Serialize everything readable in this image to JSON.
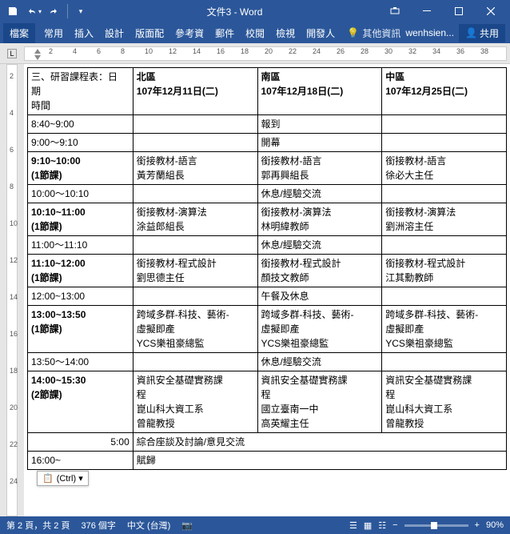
{
  "titlebar": {
    "title": "文件3 - Word"
  },
  "qat": {
    "save": "save",
    "undo": "undo",
    "redo": "redo"
  },
  "ribbon": {
    "file": "檔案",
    "tabs": [
      "常用",
      "插入",
      "設計",
      "版面配",
      "參考資",
      "郵件",
      "校閱",
      "檢視",
      "開發人"
    ],
    "tellme": "其他資訊",
    "user": "wenhsien...",
    "share": "共用"
  },
  "ruler_h": [
    "2",
    "4",
    "6",
    "8",
    "10",
    "12",
    "14",
    "16",
    "18",
    "20",
    "22",
    "24",
    "26",
    "28",
    "30",
    "32",
    "34",
    "36",
    "38"
  ],
  "ruler_v": [
    "2",
    "4",
    "6",
    "8",
    "10",
    "12",
    "14",
    "16",
    "18",
    "20",
    "22",
    "24"
  ],
  "table": {
    "r1": {
      "c1a": "三、研習課程表：日",
      "c1b": "期",
      "c1c": "時間",
      "c2": "北區",
      "c2b": "107年12月11日(二)",
      "c3": "南區",
      "c3b": "107年12月18日(二)",
      "c4": "中區",
      "c4b": "107年12月25日(二)"
    },
    "r2": {
      "c1": "8:40~9:00",
      "c3": "報到"
    },
    "r3": {
      "c1": "9:00～9:10",
      "c3": "開幕"
    },
    "r4": {
      "c1a": "9:10~10:00",
      "c1b": "(1節課)",
      "c2a": "銜接教材-語言",
      "c2b": "黃芳蘭組長",
      "c3a": "銜接教材-語言",
      "c3b": "郭再興組長",
      "c4a": "銜接教材-語言",
      "c4b": "徐必大主任"
    },
    "r5": {
      "c1": "10:00～10:10",
      "c3": "休息/經驗交流"
    },
    "r6": {
      "c1a": "10:10~11:00",
      "c1b": "(1節課)",
      "c2a": "銜接教材-演算法",
      "c2b": "涂益郎組長",
      "c3a": "銜接教材-演算法",
      "c3b": "林明緯教師",
      "c4a": "銜接教材-演算法",
      "c4b": "劉洲溶主任"
    },
    "r7": {
      "c1": "11:00～11:10",
      "c3": "休息/經驗交流"
    },
    "r8": {
      "c1a": "11:10~12:00",
      "c1b": "(1節課)",
      "c2a": "銜接教材-程式設計",
      "c2b": "劉思德主任",
      "c3a": "銜接教材-程式設計",
      "c3b": "顏技文教師",
      "c4a": "銜接教材-程式設計",
      "c4b": "江其勳教師"
    },
    "r9": {
      "c1": "12:00~13:00",
      "c3": "午餐及休息"
    },
    "r10": {
      "c1a": "13:00~13:50",
      "c1b": "(1節課)",
      "c2a": "跨域多群-科技、藝術-",
      "c2b": "虛擬即產",
      "c2c": "YCS樂祖豪總監",
      "c3a": "跨域多群-科技、藝術-",
      "c3b": "虛擬即產",
      "c3c": "YCS樂祖豪總監",
      "c4a": "跨域多群-科技、藝術-",
      "c4b": "虛擬即產",
      "c4c": "YCS樂祖豪總監"
    },
    "r11": {
      "c1": "13:50～14:00",
      "c3": "休息/經驗交流"
    },
    "r12": {
      "c1a": "14:00~15:30",
      "c1b": "(2節課)",
      "c2a": "資訊安全基礎實務課",
      "c2b": "程",
      "c2c": "崑山科大資工系",
      "c2d": "曾龍教授",
      "c3a": "資訊安全基礎實務課",
      "c3b": "程",
      "c3c": "國立臺南一中",
      "c3d": "高英耀主任",
      "c4a": "資訊安全基礎實務課",
      "c4b": "程",
      "c4c": "崑山科大資工系",
      "c4d": "曾龍教授"
    },
    "r13": {
      "c1": "5:00",
      "c3": "綜合座談及討論/意見交流"
    },
    "r14": {
      "c1": "16:00~",
      "c3": "賦歸"
    }
  },
  "paste": {
    "label": "(Ctrl) ▾"
  },
  "status": {
    "page": "第 2 頁，共 2 頁",
    "words": "376 個字",
    "lang": "中文 (台灣)",
    "zoom": "90%"
  }
}
